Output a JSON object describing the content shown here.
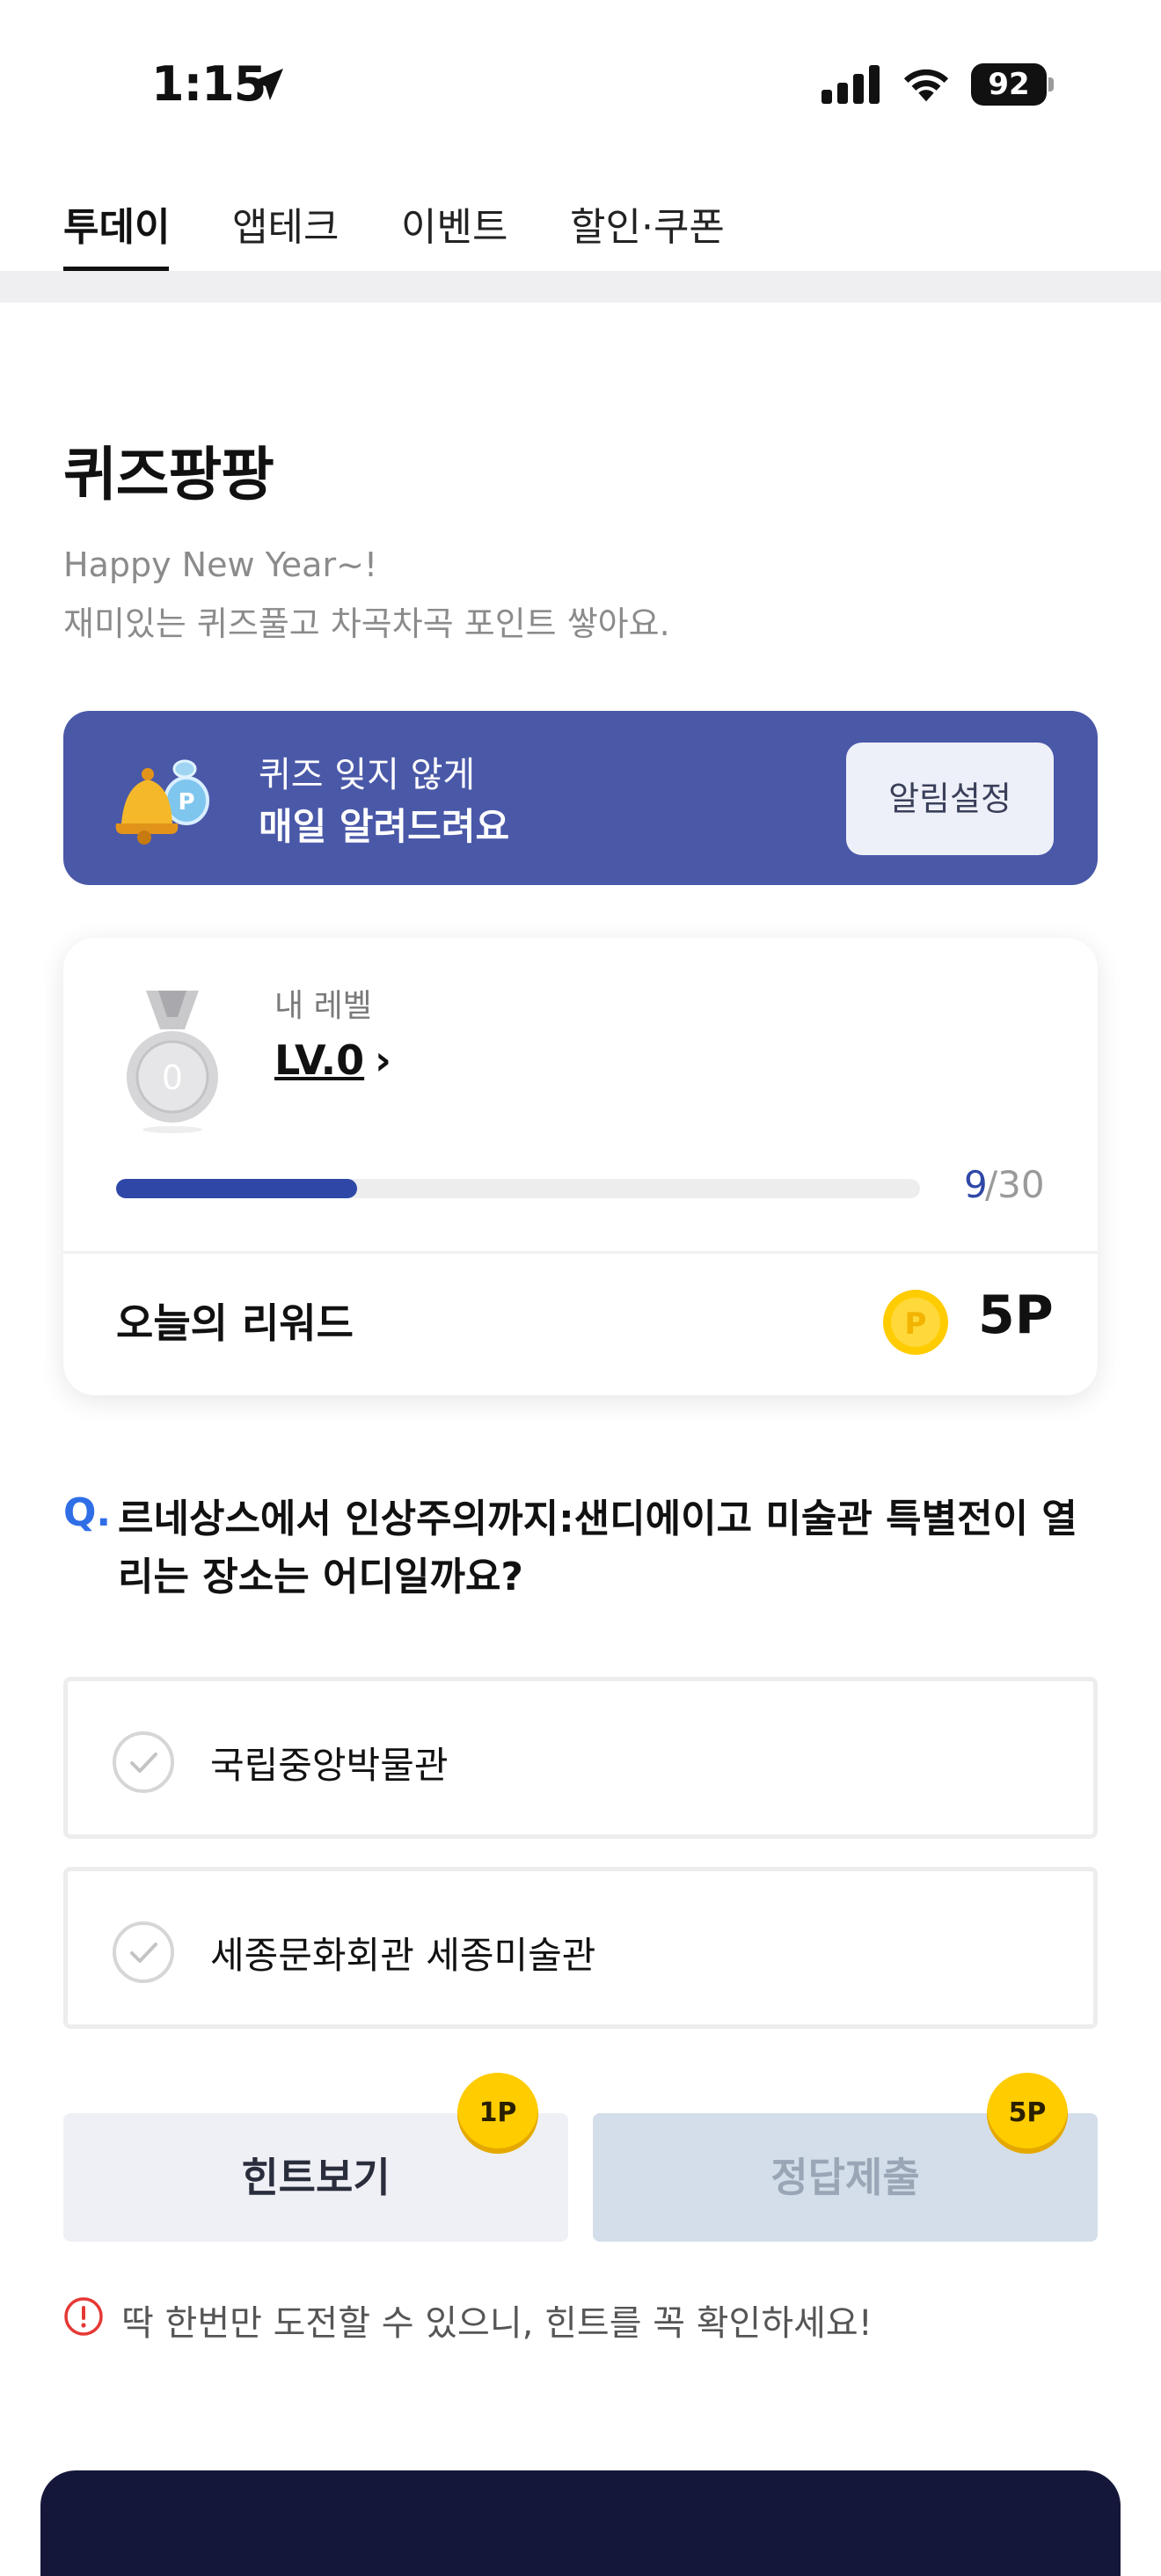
{
  "status_bar": {
    "time": "1:15",
    "battery": "92"
  },
  "tabs": [
    {
      "label": "투데이",
      "active": true
    },
    {
      "label": "앱테크",
      "active": false
    },
    {
      "label": "이벤트",
      "active": false
    },
    {
      "label": "할인·쿠폰",
      "active": false
    }
  ],
  "header": {
    "title": "퀴즈팡팡",
    "subtitle_line1": "Happy New Year~!",
    "subtitle_line2": "재미있는 퀴즈풀고 차곡차곡 포인트 쌓아요."
  },
  "banner": {
    "line1": "퀴즈 잊지 않게",
    "line2": "매일 알려드려요",
    "button_label": "알림설정"
  },
  "level_card": {
    "label": "내 레벨",
    "level": "LV.0",
    "chevron": "›",
    "medal_number": "0",
    "progress_current": "9",
    "progress_rest": "/30",
    "progress_fraction": 0.3,
    "reward_label": "오늘의 리워드",
    "reward_value": "5P"
  },
  "question": {
    "mark": "Q.",
    "text": "르네상스에서 인상주의까지:샌디에이고 미술관 특별전이 열리는 장소는 어디일까요?"
  },
  "answers": [
    {
      "label": "국립중앙박물관"
    },
    {
      "label": "세종문화회관 세종미술관"
    }
  ],
  "actions": {
    "hint_label": "힌트보기",
    "hint_cost": "1P",
    "submit_label": "정답제출",
    "submit_reward": "5P"
  },
  "warning": "딱 한번만 도전할 수 있으니, 힌트를 꼭 확인하세요!",
  "colors": {
    "banner": "#4a58a8",
    "progress": "#2f48a8",
    "question_mark": "#2f6ee6",
    "coin": "#ffcc00"
  }
}
